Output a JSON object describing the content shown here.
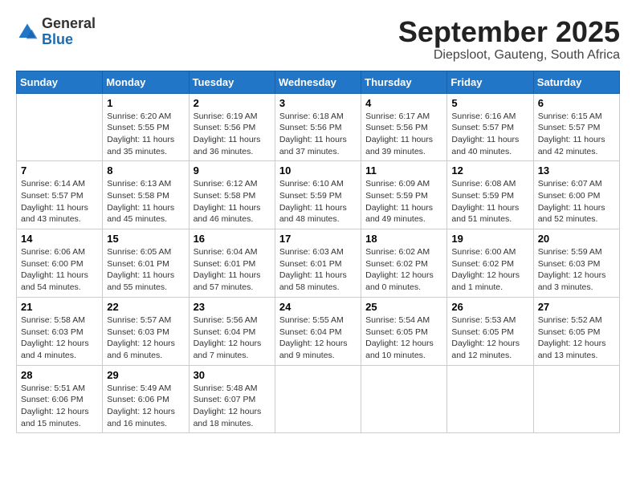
{
  "header": {
    "logo": {
      "general": "General",
      "blue": "Blue"
    },
    "title": "September 2025",
    "subtitle": "Diepsloot, Gauteng, South Africa"
  },
  "calendar": {
    "days_of_week": [
      "Sunday",
      "Monday",
      "Tuesday",
      "Wednesday",
      "Thursday",
      "Friday",
      "Saturday"
    ],
    "weeks": [
      [
        {
          "day": "",
          "sunrise": "",
          "sunset": "",
          "daylight": ""
        },
        {
          "day": "1",
          "sunrise": "Sunrise: 6:20 AM",
          "sunset": "Sunset: 5:55 PM",
          "daylight": "Daylight: 11 hours and 35 minutes."
        },
        {
          "day": "2",
          "sunrise": "Sunrise: 6:19 AM",
          "sunset": "Sunset: 5:56 PM",
          "daylight": "Daylight: 11 hours and 36 minutes."
        },
        {
          "day": "3",
          "sunrise": "Sunrise: 6:18 AM",
          "sunset": "Sunset: 5:56 PM",
          "daylight": "Daylight: 11 hours and 37 minutes."
        },
        {
          "day": "4",
          "sunrise": "Sunrise: 6:17 AM",
          "sunset": "Sunset: 5:56 PM",
          "daylight": "Daylight: 11 hours and 39 minutes."
        },
        {
          "day": "5",
          "sunrise": "Sunrise: 6:16 AM",
          "sunset": "Sunset: 5:57 PM",
          "daylight": "Daylight: 11 hours and 40 minutes."
        },
        {
          "day": "6",
          "sunrise": "Sunrise: 6:15 AM",
          "sunset": "Sunset: 5:57 PM",
          "daylight": "Daylight: 11 hours and 42 minutes."
        }
      ],
      [
        {
          "day": "7",
          "sunrise": "Sunrise: 6:14 AM",
          "sunset": "Sunset: 5:57 PM",
          "daylight": "Daylight: 11 hours and 43 minutes."
        },
        {
          "day": "8",
          "sunrise": "Sunrise: 6:13 AM",
          "sunset": "Sunset: 5:58 PM",
          "daylight": "Daylight: 11 hours and 45 minutes."
        },
        {
          "day": "9",
          "sunrise": "Sunrise: 6:12 AM",
          "sunset": "Sunset: 5:58 PM",
          "daylight": "Daylight: 11 hours and 46 minutes."
        },
        {
          "day": "10",
          "sunrise": "Sunrise: 6:10 AM",
          "sunset": "Sunset: 5:59 PM",
          "daylight": "Daylight: 11 hours and 48 minutes."
        },
        {
          "day": "11",
          "sunrise": "Sunrise: 6:09 AM",
          "sunset": "Sunset: 5:59 PM",
          "daylight": "Daylight: 11 hours and 49 minutes."
        },
        {
          "day": "12",
          "sunrise": "Sunrise: 6:08 AM",
          "sunset": "Sunset: 5:59 PM",
          "daylight": "Daylight: 11 hours and 51 minutes."
        },
        {
          "day": "13",
          "sunrise": "Sunrise: 6:07 AM",
          "sunset": "Sunset: 6:00 PM",
          "daylight": "Daylight: 11 hours and 52 minutes."
        }
      ],
      [
        {
          "day": "14",
          "sunrise": "Sunrise: 6:06 AM",
          "sunset": "Sunset: 6:00 PM",
          "daylight": "Daylight: 11 hours and 54 minutes."
        },
        {
          "day": "15",
          "sunrise": "Sunrise: 6:05 AM",
          "sunset": "Sunset: 6:01 PM",
          "daylight": "Daylight: 11 hours and 55 minutes."
        },
        {
          "day": "16",
          "sunrise": "Sunrise: 6:04 AM",
          "sunset": "Sunset: 6:01 PM",
          "daylight": "Daylight: 11 hours and 57 minutes."
        },
        {
          "day": "17",
          "sunrise": "Sunrise: 6:03 AM",
          "sunset": "Sunset: 6:01 PM",
          "daylight": "Daylight: 11 hours and 58 minutes."
        },
        {
          "day": "18",
          "sunrise": "Sunrise: 6:02 AM",
          "sunset": "Sunset: 6:02 PM",
          "daylight": "Daylight: 12 hours and 0 minutes."
        },
        {
          "day": "19",
          "sunrise": "Sunrise: 6:00 AM",
          "sunset": "Sunset: 6:02 PM",
          "daylight": "Daylight: 12 hours and 1 minute."
        },
        {
          "day": "20",
          "sunrise": "Sunrise: 5:59 AM",
          "sunset": "Sunset: 6:03 PM",
          "daylight": "Daylight: 12 hours and 3 minutes."
        }
      ],
      [
        {
          "day": "21",
          "sunrise": "Sunrise: 5:58 AM",
          "sunset": "Sunset: 6:03 PM",
          "daylight": "Daylight: 12 hours and 4 minutes."
        },
        {
          "day": "22",
          "sunrise": "Sunrise: 5:57 AM",
          "sunset": "Sunset: 6:03 PM",
          "daylight": "Daylight: 12 hours and 6 minutes."
        },
        {
          "day": "23",
          "sunrise": "Sunrise: 5:56 AM",
          "sunset": "Sunset: 6:04 PM",
          "daylight": "Daylight: 12 hours and 7 minutes."
        },
        {
          "day": "24",
          "sunrise": "Sunrise: 5:55 AM",
          "sunset": "Sunset: 6:04 PM",
          "daylight": "Daylight: 12 hours and 9 minutes."
        },
        {
          "day": "25",
          "sunrise": "Sunrise: 5:54 AM",
          "sunset": "Sunset: 6:05 PM",
          "daylight": "Daylight: 12 hours and 10 minutes."
        },
        {
          "day": "26",
          "sunrise": "Sunrise: 5:53 AM",
          "sunset": "Sunset: 6:05 PM",
          "daylight": "Daylight: 12 hours and 12 minutes."
        },
        {
          "day": "27",
          "sunrise": "Sunrise: 5:52 AM",
          "sunset": "Sunset: 6:05 PM",
          "daylight": "Daylight: 12 hours and 13 minutes."
        }
      ],
      [
        {
          "day": "28",
          "sunrise": "Sunrise: 5:51 AM",
          "sunset": "Sunset: 6:06 PM",
          "daylight": "Daylight: 12 hours and 15 minutes."
        },
        {
          "day": "29",
          "sunrise": "Sunrise: 5:49 AM",
          "sunset": "Sunset: 6:06 PM",
          "daylight": "Daylight: 12 hours and 16 minutes."
        },
        {
          "day": "30",
          "sunrise": "Sunrise: 5:48 AM",
          "sunset": "Sunset: 6:07 PM",
          "daylight": "Daylight: 12 hours and 18 minutes."
        },
        {
          "day": "",
          "sunrise": "",
          "sunset": "",
          "daylight": ""
        },
        {
          "day": "",
          "sunrise": "",
          "sunset": "",
          "daylight": ""
        },
        {
          "day": "",
          "sunrise": "",
          "sunset": "",
          "daylight": ""
        },
        {
          "day": "",
          "sunrise": "",
          "sunset": "",
          "daylight": ""
        }
      ]
    ]
  }
}
